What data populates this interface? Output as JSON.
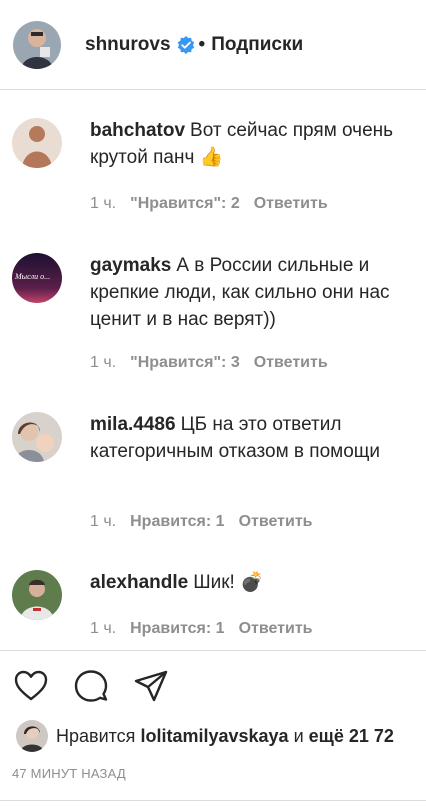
{
  "header": {
    "username": "shnurovs",
    "separator": "•",
    "follow_label": "Подписки"
  },
  "comments": [
    {
      "author": "bahchatov",
      "text": "Вот сейчас прям очень крутой панч 👍",
      "time": "1 ч.",
      "likes": "\"Нравится\": 2",
      "reply": "Ответить",
      "avatar_color": "#c79a86"
    },
    {
      "author": "gaymaks",
      "text": "А в России сильные и крепкие люди, как сильно они нас ценит и в нас верят))",
      "time": "1 ч.",
      "likes": "\"Нравится\": 3",
      "reply": "Ответить",
      "avatar_text": "Мысли о...",
      "avatar_color": "#3b1a3f"
    },
    {
      "author": "mila.4486",
      "text": "ЦБ на это ответил категоричным отказом в помощи",
      "time": "1 ч.",
      "likes": "Нравится: 1",
      "reply": "Ответить",
      "avatar_color": "#b8a89a"
    },
    {
      "author": "alexhandle",
      "text": "Шик! 💣",
      "time": "1 ч.",
      "likes": "Нравится: 1",
      "reply": "Ответить",
      "avatar_color": "#6f8a5a"
    }
  ],
  "likes_row": {
    "prefix": "Нравится",
    "user": "lolitamilyavskaya",
    "connector": "и",
    "others": "ещё 21 72"
  },
  "time_ago": "47 МИНУТ НАЗАД",
  "colors": {
    "text": "#262626",
    "muted": "#8e8e8e",
    "divider": "#dbdbdb",
    "verified_blue": "#3897f0"
  }
}
